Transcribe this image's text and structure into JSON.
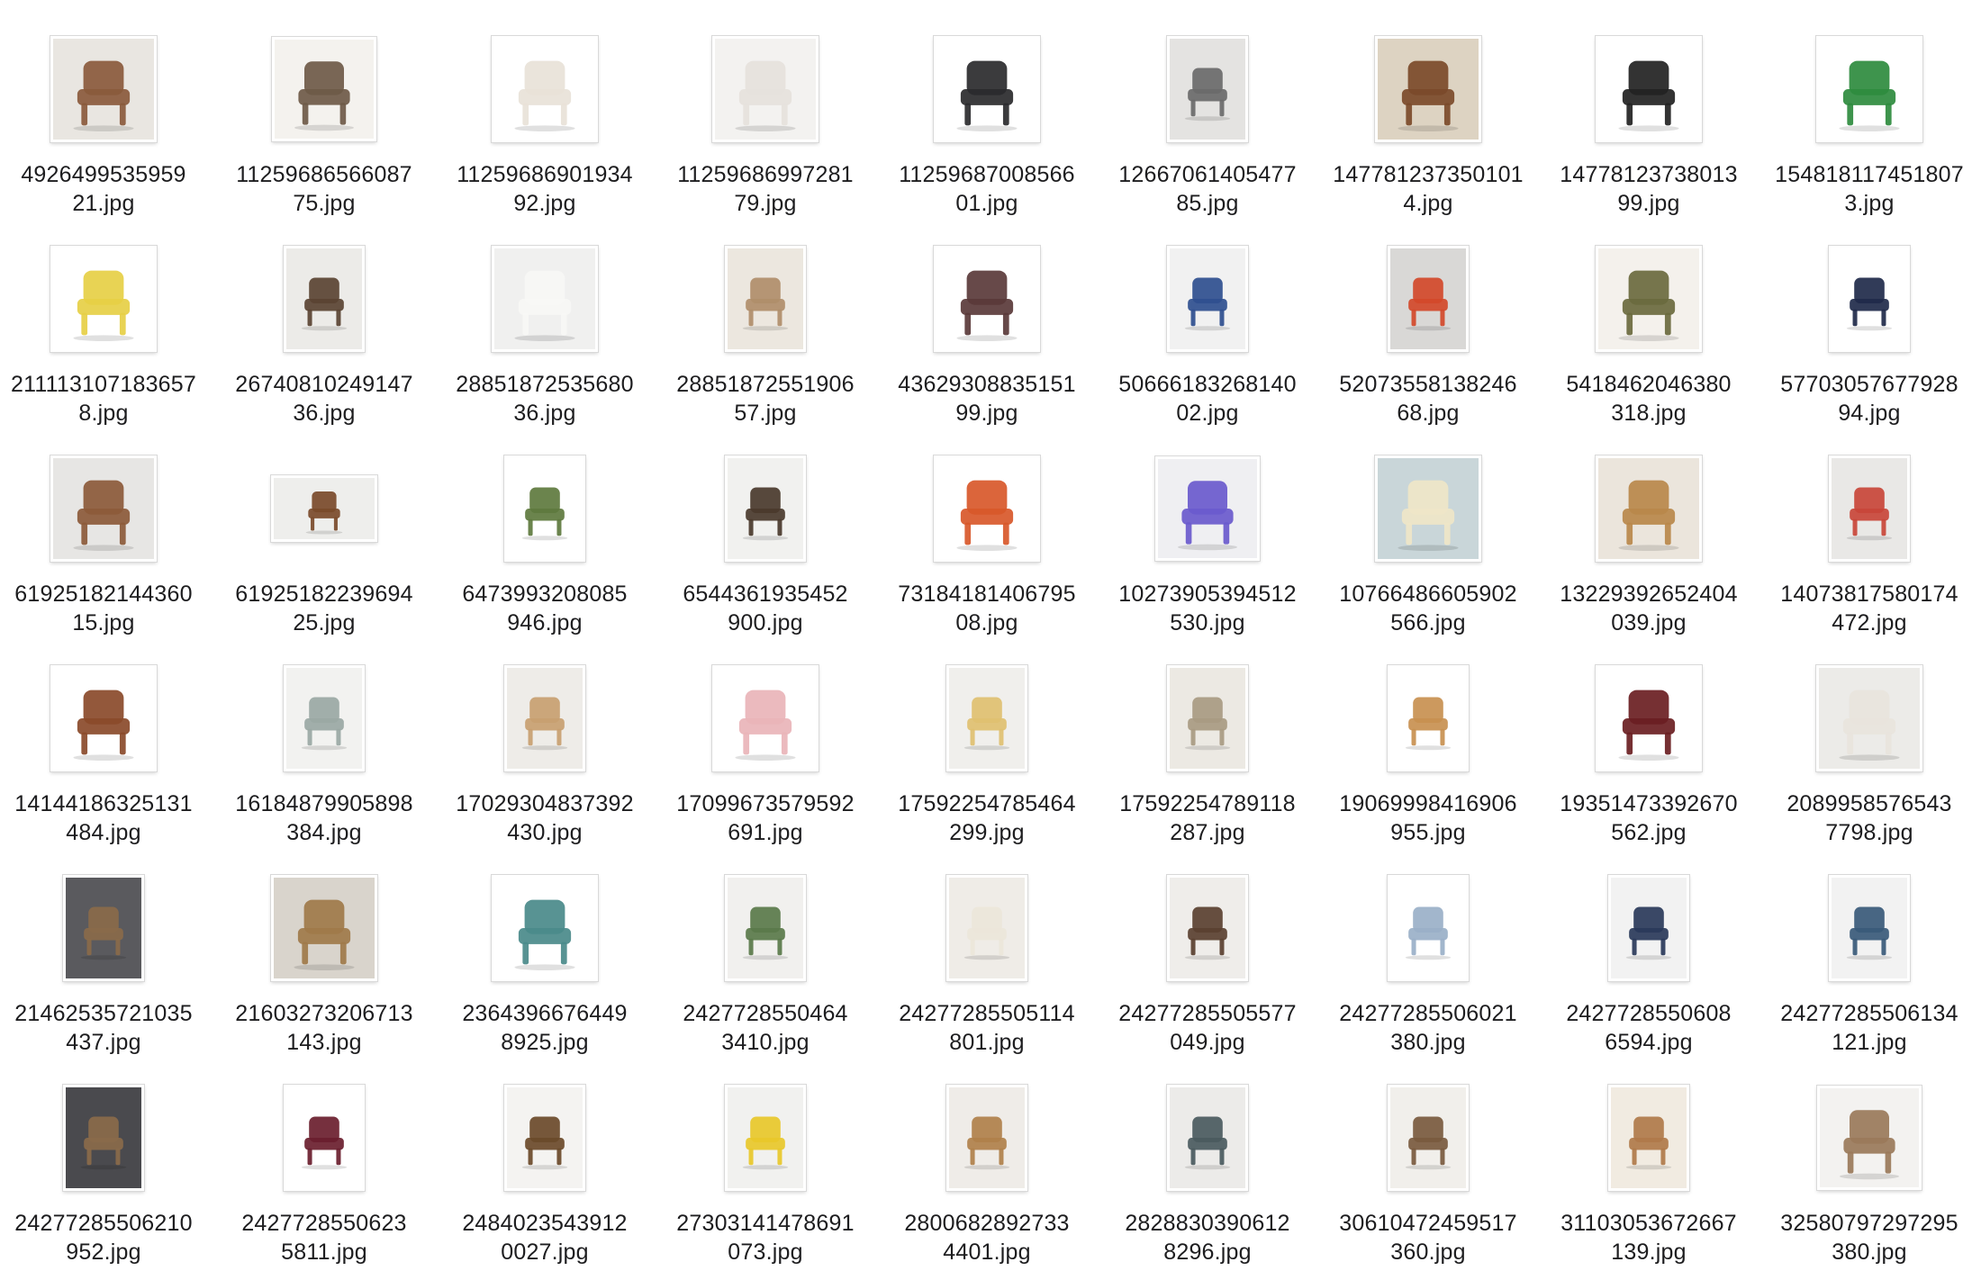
{
  "files": [
    {
      "line1": "4926499535959",
      "line2": "21.jpg",
      "icon": "chair-thumbnail-icon",
      "bg": "#e9e6e1",
      "color": "#8a5a3c",
      "shape": "wide"
    },
    {
      "line1": "11259686566087",
      "line2": "75.jpg",
      "icon": "chair-thumbnail-icon",
      "bg": "#f4f2ee",
      "color": "#6e5a48",
      "shape": "square"
    },
    {
      "line1": "11259686901934",
      "line2": "92.jpg",
      "icon": "chair-thumbnail-icon",
      "bg": "#ffffff",
      "color": "#e8e2d8",
      "shape": "wide"
    },
    {
      "line1": "11259686997281",
      "line2": "79.jpg",
      "icon": "chair-thumbnail-icon",
      "bg": "#f3f2f0",
      "color": "#e6e2dc",
      "shape": "wide"
    },
    {
      "line1": "11259687008566",
      "line2": "01.jpg",
      "icon": "chair-thumbnail-icon",
      "bg": "#ffffff",
      "color": "#2a2a2c",
      "shape": "wide"
    },
    {
      "line1": "12667061405477",
      "line2": "85.jpg",
      "icon": "chair-thumbnail-icon",
      "bg": "#e4e3e1",
      "color": "#6a6a6a",
      "shape": "tall"
    },
    {
      "line1": "147781237350101",
      "line2": "4.jpg",
      "icon": "chair-thumbnail-icon",
      "bg": "#ddd3c2",
      "color": "#7b4a2a",
      "shape": "wide"
    },
    {
      "line1": "14778123738013",
      "line2": "99.jpg",
      "icon": "chair-thumbnail-icon",
      "bg": "#ffffff",
      "color": "#222222",
      "shape": "wide"
    },
    {
      "line1": "154818117451807",
      "line2": "3.jpg",
      "icon": "chair-thumbnail-icon",
      "bg": "#ffffff",
      "color": "#2e8b3e",
      "shape": "wide"
    },
    {
      "line1": "211113107183657",
      "line2": "8.jpg",
      "icon": "chair-thumbnail-icon",
      "bg": "#ffffff",
      "color": "#e6cf45",
      "shape": "wide"
    },
    {
      "line1": "26740810249147",
      "line2": "36.jpg",
      "icon": "chair-thumbnail-icon",
      "bg": "#ecebe8",
      "color": "#5a4332",
      "shape": "tall"
    },
    {
      "line1": "28851872535680",
      "line2": "36.jpg",
      "icon": "chair-thumbnail-icon",
      "bg": "#f0f0ef",
      "color": "#f7f7f5",
      "shape": "wide"
    },
    {
      "line1": "28851872551906",
      "line2": "57.jpg",
      "icon": "chair-thumbnail-icon",
      "bg": "#ece7df",
      "color": "#b08e6a",
      "shape": "tall"
    },
    {
      "line1": "43629308835151",
      "line2": "99.jpg",
      "icon": "chair-thumbnail-icon",
      "bg": "#ffffff",
      "color": "#5a3a3a",
      "shape": "wide"
    },
    {
      "line1": "50666183268140",
      "line2": "02.jpg",
      "icon": "chair-thumbnail-icon",
      "bg": "#f1f1f1",
      "color": "#2f4f8f",
      "shape": "tall"
    },
    {
      "line1": "52073558138246",
      "line2": "68.jpg",
      "icon": "chair-thumbnail-icon",
      "bg": "#d9d8d6",
      "color": "#d2492a",
      "shape": "tall"
    },
    {
      "line1": "5418462046380",
      "line2": "318.jpg",
      "icon": "chair-thumbnail-icon",
      "bg": "#f4f1ec",
      "color": "#6a6a3e",
      "shape": "wide"
    },
    {
      "line1": "57703057677928",
      "line2": "94.jpg",
      "icon": "chair-thumbnail-icon",
      "bg": "#ffffff",
      "color": "#1f2a4a",
      "shape": "tall"
    },
    {
      "line1": "61925182144360",
      "line2": "15.jpg",
      "icon": "chair-thumbnail-icon",
      "bg": "#e7e6e4",
      "color": "#8c5a3a",
      "shape": "wide"
    },
    {
      "line1": "61925182239694",
      "line2": "25.jpg",
      "icon": "chair-thumbnail-icon",
      "bg": "#eeeeec",
      "color": "#7a4a2a",
      "shape": "flat"
    },
    {
      "line1": "6473993208085",
      "line2": "946.jpg",
      "icon": "chair-thumbnail-icon",
      "bg": "#ffffff",
      "color": "#5e7a3e",
      "shape": "tall"
    },
    {
      "line1": "6544361935452",
      "line2": "900.jpg",
      "icon": "chair-thumbnail-icon",
      "bg": "#f1f1ef",
      "color": "#4a3a2c",
      "shape": "tall"
    },
    {
      "line1": "73184181406795",
      "line2": "08.jpg",
      "icon": "chair-thumbnail-icon",
      "bg": "#ffffff",
      "color": "#d8582a",
      "shape": "wide"
    },
    {
      "line1": "10273905394512",
      "line2": "530.jpg",
      "icon": "chair-thumbnail-icon",
      "bg": "#efeff2",
      "color": "#6a5acd",
      "shape": "square"
    },
    {
      "line1": "10766486605902",
      "line2": "566.jpg",
      "icon": "chair-thumbnail-icon",
      "bg": "#c9d6d9",
      "color": "#efe6c8",
      "shape": "wide"
    },
    {
      "line1": "13229392652404",
      "line2": "039.jpg",
      "icon": "chair-thumbnail-icon",
      "bg": "#ebe5dc",
      "color": "#b8884a",
      "shape": "wide"
    },
    {
      "line1": "14073817580174",
      "line2": "472.jpg",
      "icon": "chair-thumbnail-icon",
      "bg": "#e9e8e6",
      "color": "#c8453a",
      "shape": "tall"
    },
    {
      "line1": "14144186325131",
      "line2": "484.jpg",
      "icon": "chair-thumbnail-icon",
      "bg": "#ffffff",
      "color": "#8a4a2a",
      "shape": "wide"
    },
    {
      "line1": "16184879905898",
      "line2": "384.jpg",
      "icon": "chair-thumbnail-icon",
      "bg": "#f2f2f0",
      "color": "#9aa8a4",
      "shape": "tall"
    },
    {
      "line1": "17029304837392",
      "line2": "430.jpg",
      "icon": "chair-thumbnail-icon",
      "bg": "#eeece8",
      "color": "#c8a070",
      "shape": "tall"
    },
    {
      "line1": "17099673579592",
      "line2": "691.jpg",
      "icon": "chair-thumbnail-icon",
      "bg": "#ffffff",
      "color": "#e9b4b8",
      "shape": "wide"
    },
    {
      "line1": "17592254785464",
      "line2": "299.jpg",
      "icon": "chair-thumbnail-icon",
      "bg": "#f0efec",
      "color": "#e0c070",
      "shape": "tall"
    },
    {
      "line1": "17592254789118",
      "line2": "287.jpg",
      "icon": "chair-thumbnail-icon",
      "bg": "#ece9e3",
      "color": "#a89a82",
      "shape": "tall"
    },
    {
      "line1": "19069998416906",
      "line2": "955.jpg",
      "icon": "chair-thumbnail-icon",
      "bg": "#ffffff",
      "color": "#c89050",
      "shape": "tall"
    },
    {
      "line1": "19351473392670",
      "line2": "562.jpg",
      "icon": "chair-thumbnail-icon",
      "bg": "#ffffff",
      "color": "#6a1e22",
      "shape": "wide"
    },
    {
      "line1": "2089958576543",
      "line2": "7798.jpg",
      "icon": "chair-thumbnail-icon",
      "bg": "#ecebe8",
      "color": "#e8e4dc",
      "shape": "wide"
    },
    {
      "line1": "21462535721035",
      "line2": "437.jpg",
      "icon": "chair-thumbnail-icon",
      "bg": "#5a5a5e",
      "color": "#8a6a4a",
      "shape": "tall"
    },
    {
      "line1": "21603273206713",
      "line2": "143.jpg",
      "icon": "chair-thumbnail-icon",
      "bg": "#d9d4cc",
      "color": "#a07a4a",
      "shape": "wide"
    },
    {
      "line1": "2364396676449",
      "line2": "8925.jpg",
      "icon": "chair-thumbnail-icon",
      "bg": "#ffffff",
      "color": "#4a8a8a",
      "shape": "wide"
    },
    {
      "line1": "2427728550464",
      "line2": "3410.jpg",
      "icon": "chair-thumbnail-icon",
      "bg": "#f1f0ee",
      "color": "#5a7a4a",
      "shape": "tall"
    },
    {
      "line1": "24277285505114",
      "line2": "801.jpg",
      "icon": "chair-thumbnail-icon",
      "bg": "#efece7",
      "color": "#ece6da",
      "shape": "tall"
    },
    {
      "line1": "24277285505577",
      "line2": "049.jpg",
      "icon": "chair-thumbnail-icon",
      "bg": "#efedea",
      "color": "#5a4030",
      "shape": "tall"
    },
    {
      "line1": "24277285506021",
      "line2": "380.jpg",
      "icon": "chair-thumbnail-icon",
      "bg": "#ffffff",
      "color": "#9ab0c8",
      "shape": "tall"
    },
    {
      "line1": "2427728550608",
      "line2": "6594.jpg",
      "icon": "chair-thumbnail-icon",
      "bg": "#f2f2f2",
      "color": "#2a3a5a",
      "shape": "tall"
    },
    {
      "line1": "24277285506134",
      "line2": "121.jpg",
      "icon": "chair-thumbnail-icon",
      "bg": "#f2f2f2",
      "color": "#3a5a7a",
      "shape": "tall"
    },
    {
      "line1": "24277285506210",
      "line2": "952.jpg",
      "icon": "chair-thumbnail-icon",
      "bg": "#4a4a4e",
      "color": "#8a6a4a",
      "shape": "tall"
    },
    {
      "line1": "2427728550623",
      "line2": "5811.jpg",
      "icon": "chair-thumbnail-icon",
      "bg": "#ffffff",
      "color": "#6a1e2e",
      "shape": "tall"
    },
    {
      "line1": "2484023543912",
      "line2": "0027.jpg",
      "icon": "chair-thumbnail-icon",
      "bg": "#f4f3f1",
      "color": "#6a4a2a",
      "shape": "tall"
    },
    {
      "line1": "27303141478691",
      "line2": "073.jpg",
      "icon": "chair-thumbnail-icon",
      "bg": "#f1f1ef",
      "color": "#e8c82a",
      "shape": "tall"
    },
    {
      "line1": "2800682892733",
      "line2": "4401.jpg",
      "icon": "chair-thumbnail-icon",
      "bg": "#efece8",
      "color": "#b0804a",
      "shape": "tall"
    },
    {
      "line1": "2828830390612",
      "line2": "8296.jpg",
      "icon": "chair-thumbnail-icon",
      "bg": "#ecebe9",
      "color": "#4a5a5e",
      "shape": "tall"
    },
    {
      "line1": "30610472459517",
      "line2": "360.jpg",
      "icon": "chair-thumbnail-icon",
      "bg": "#f1efeb",
      "color": "#7a5a3e",
      "shape": "tall"
    },
    {
      "line1": "31103053672667",
      "line2": "139.jpg",
      "icon": "chair-thumbnail-icon",
      "bg": "#f1ebe1",
      "color": "#b07a4a",
      "shape": "tall"
    },
    {
      "line1": "32580797297295",
      "line2": "380.jpg",
      "icon": "chair-thumbnail-icon",
      "bg": "#f3f2f0",
      "color": "#9a7a5a",
      "shape": "square"
    }
  ]
}
